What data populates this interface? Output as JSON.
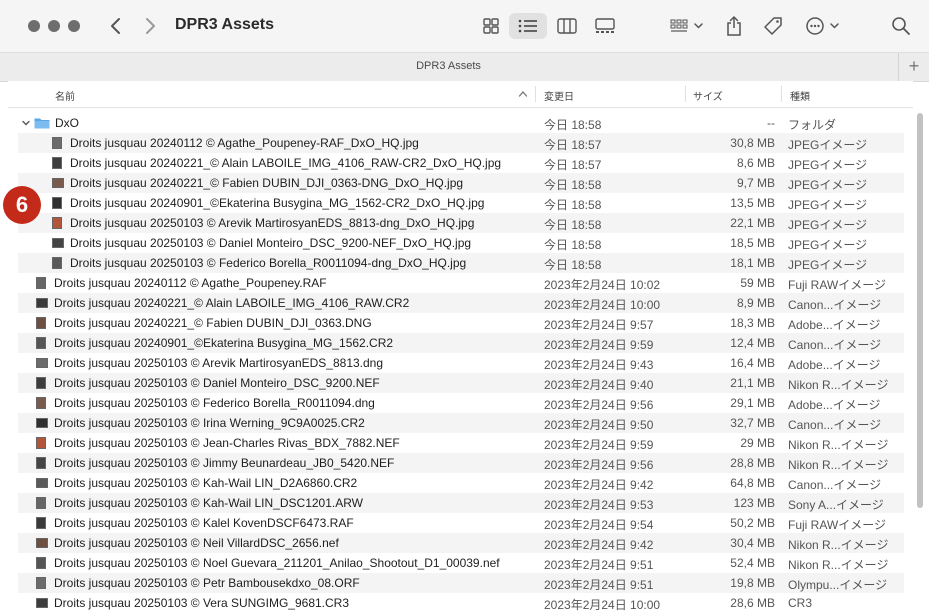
{
  "window": {
    "title": "DPR3 Assets",
    "tab_title": "DPR3 Assets"
  },
  "toolbar": {
    "icons": [
      "chevron-left-icon",
      "chevron-right-icon",
      "icon-view-icon",
      "list-view-icon",
      "column-view-icon",
      "gallery-view-icon",
      "group-icon",
      "share-icon",
      "tag-icon",
      "more-icon",
      "search-icon"
    ],
    "new_tab": "+"
  },
  "columns": {
    "name": "名前",
    "modified": "変更日",
    "size": "サイズ",
    "kind": "種類"
  },
  "rows": [
    {
      "name": "DxO",
      "date": "今日 18:58",
      "size": "--",
      "kind": "フォルダ"
    },
    {
      "name": "Droits jusquau 20240112 © Agathe_Poupeney-RAF_DxO_HQ.jpg",
      "date": "今日 18:57",
      "size": "30,8 MB",
      "kind": "JPEGイメージ"
    },
    {
      "name": "Droits jusquau 20240221_© Alain LABOILE_IMG_4106_RAW-CR2_DxO_HQ.jpg",
      "date": "今日 18:57",
      "size": "8,6 MB",
      "kind": "JPEGイメージ"
    },
    {
      "name": "Droits jusquau 20240221_© Fabien DUBIN_DJI_0363-DNG_DxO_HQ.jpg",
      "date": "今日 18:58",
      "size": "9,7 MB",
      "kind": "JPEGイメージ"
    },
    {
      "name": "Droits jusquau 20240901_©Ekaterina Busygina_MG_1562-CR2_DxO_HQ.jpg",
      "date": "今日 18:58",
      "size": "13,5 MB",
      "kind": "JPEGイメージ"
    },
    {
      "name": "Droits jusquau 20250103 © Arevik MartirosyanEDS_8813-dng_DxO_HQ.jpg",
      "date": "今日 18:58",
      "size": "22,1 MB",
      "kind": "JPEGイメージ"
    },
    {
      "name": "Droits jusquau 20250103 © Daniel Monteiro_DSC_9200-NEF_DxO_HQ.jpg",
      "date": "今日 18:58",
      "size": "18,5 MB",
      "kind": "JPEGイメージ"
    },
    {
      "name": "Droits jusquau 20250103 © Federico Borella_R0011094-dng_DxO_HQ.jpg",
      "date": "今日 18:58",
      "size": "18,1 MB",
      "kind": "JPEGイメージ"
    },
    {
      "name": "Droits jusquau 20240112 © Agathe_Poupeney.RAF",
      "date": "2023年2月24日 10:02",
      "size": "59 MB",
      "kind": "Fuji RAWイメージ"
    },
    {
      "name": "Droits jusquau 20240221_© Alain LABOILE_IMG_4106_RAW.CR2",
      "date": "2023年2月24日 10:00",
      "size": "8,9 MB",
      "kind": "Canon...イメージ"
    },
    {
      "name": "Droits jusquau 20240221_© Fabien DUBIN_DJI_0363.DNG",
      "date": "2023年2月24日 9:57",
      "size": "18,3 MB",
      "kind": "Adobe...イメージ"
    },
    {
      "name": "Droits jusquau 20240901_©Ekaterina Busygina_MG_1562.CR2",
      "date": "2023年2月24日 9:59",
      "size": "12,4 MB",
      "kind": "Canon...イメージ"
    },
    {
      "name": "Droits jusquau 20250103 © Arevik MartirosyanEDS_8813.dng",
      "date": "2023年2月24日 9:43",
      "size": "16,4 MB",
      "kind": "Adobe...イメージ"
    },
    {
      "name": "Droits jusquau 20250103 © Daniel Monteiro_DSC_9200.NEF",
      "date": "2023年2月24日 9:40",
      "size": "21,1 MB",
      "kind": "Nikon R...イメージ"
    },
    {
      "name": "Droits jusquau 20250103 © Federico Borella_R0011094.dng",
      "date": "2023年2月24日 9:56",
      "size": "29,1 MB",
      "kind": "Adobe...イメージ"
    },
    {
      "name": "Droits jusquau 20250103 © Irina Werning_9C9A0025.CR2",
      "date": "2023年2月24日 9:50",
      "size": "32,7 MB",
      "kind": "Canon...イメージ"
    },
    {
      "name": "Droits jusquau 20250103 © Jean-Charles Rivas_BDX_7882.NEF",
      "date": "2023年2月24日 9:59",
      "size": "29 MB",
      "kind": "Nikon R...イメージ"
    },
    {
      "name": "Droits jusquau 20250103 © Jimmy Beunardeau_JB0_5420.NEF",
      "date": "2023年2月24日 9:56",
      "size": "28,8 MB",
      "kind": "Nikon R...イメージ"
    },
    {
      "name": "Droits jusquau 20250103 © Kah-Wail LIN_D2A6860.CR2",
      "date": "2023年2月24日 9:42",
      "size": "64,8 MB",
      "kind": "Canon...イメージ"
    },
    {
      "name": "Droits jusquau 20250103 © Kah-Wail LIN_DSC1201.ARW",
      "date": "2023年2月24日 9:53",
      "size": "123 MB",
      "kind": "Sony A...イメージ"
    },
    {
      "name": "Droits jusquau 20250103 © Kalel KovenDSCF6473.RAF",
      "date": "2023年2月24日 9:54",
      "size": "50,2 MB",
      "kind": "Fuji RAWイメージ"
    },
    {
      "name": "Droits jusquau 20250103 © Neil VillardDSC_2656.nef",
      "date": "2023年2月24日 9:42",
      "size": "30,4 MB",
      "kind": "Nikon R...イメージ"
    },
    {
      "name": "Droits jusquau 20250103 © Noel Guevara_211201_Anilao_Shootout_D1_00039.nef",
      "date": "2023年2月24日 9:51",
      "size": "52,4 MB",
      "kind": "Nikon R...イメージ"
    },
    {
      "name": "Droits jusquau 20250103 © Petr Bambousekdxo_08.ORF",
      "date": "2023年2月24日 9:51",
      "size": "19,8 MB",
      "kind": "Olympu...イメージ"
    },
    {
      "name": "Droits jusquau 20250103 © Vera SUNGIMG_9681.CR3",
      "date": "2023年2月24日 10:00",
      "size": "28,6 MB",
      "kind": "CR3"
    }
  ],
  "badge": {
    "label": "6",
    "color": "#c42a19"
  },
  "colors": {
    "folder": "#5aa7e6",
    "selected_view": "#e1e1e1"
  }
}
